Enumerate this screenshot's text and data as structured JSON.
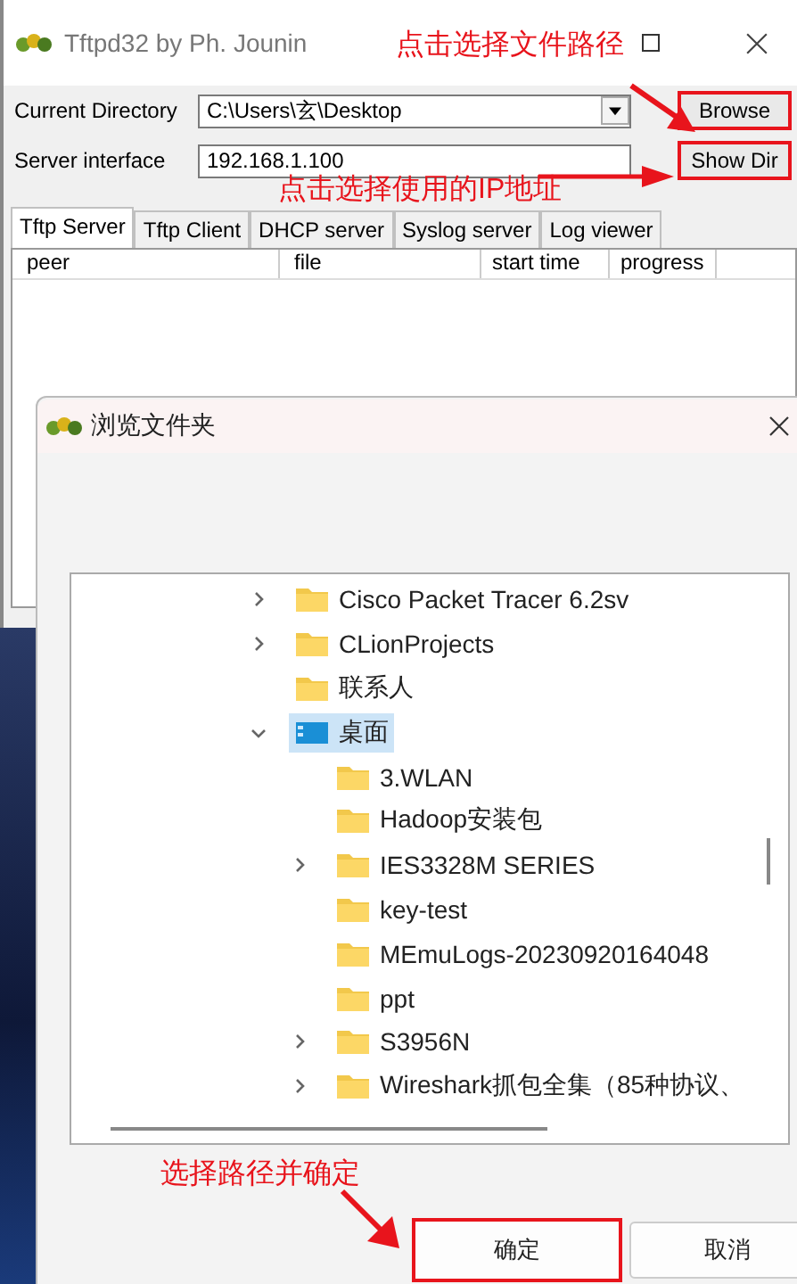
{
  "main_window": {
    "title": "Tftpd32 by Ph. Jounin",
    "current_directory": {
      "label": "Current Directory",
      "value": "C:\\Users\\玄\\Desktop"
    },
    "server_interface": {
      "label": "Server interface",
      "value": "192.168.1.100"
    },
    "buttons": [
      {
        "label": "Browse",
        "highlighted": true
      },
      {
        "label": "Show Dir",
        "highlighted": true
      }
    ],
    "tabs": [
      {
        "label": "Tftp Server",
        "selected": true
      },
      {
        "label": "Tftp Client",
        "selected": false
      },
      {
        "label": "DHCP server",
        "selected": false
      },
      {
        "label": "Syslog server",
        "selected": false
      },
      {
        "label": "Log viewer",
        "selected": false
      }
    ],
    "table": {
      "columns": [
        "peer",
        "file",
        "start time",
        "progress"
      ]
    }
  },
  "dialog": {
    "title": "浏览文件夹",
    "tree": [
      {
        "label": "Cisco Packet Tracer 6.2sv",
        "expanded": false,
        "selected": false,
        "kind": "folder"
      },
      {
        "label": "CLionProjects",
        "expanded": false,
        "selected": false,
        "kind": "folder"
      },
      {
        "label": "联系人",
        "selected": false,
        "kind": "folder"
      },
      {
        "label": "桌面",
        "expanded": true,
        "selected": true,
        "kind": "desktop",
        "children": [
          {
            "label": "3.WLAN",
            "selected": false,
            "kind": "folder"
          },
          {
            "label": "Hadoop安装包",
            "selected": false,
            "kind": "folder"
          },
          {
            "label": "IES3328M SERIES",
            "expanded": false,
            "selected": false,
            "kind": "folder"
          },
          {
            "label": "key-test",
            "selected": false,
            "kind": "folder"
          },
          {
            "label": "MEmuLogs-20230920164048",
            "selected": false,
            "kind": "folder"
          },
          {
            "label": "ppt",
            "selected": false,
            "kind": "folder"
          },
          {
            "label": "S3956N",
            "expanded": false,
            "selected": false,
            "kind": "folder"
          },
          {
            "label": "Wireshark抓包全集（85种协议、",
            "expanded": false,
            "selected": false,
            "kind": "folder"
          }
        ]
      }
    ],
    "buttons": [
      {
        "label": "确定",
        "highlighted": true
      },
      {
        "label": "取消",
        "highlighted": false
      }
    ]
  },
  "annotations": [
    {
      "text": "点击选择文件路径"
    },
    {
      "text": "点击选择使用的IP地址"
    },
    {
      "text": "选择路径并确定"
    }
  ]
}
